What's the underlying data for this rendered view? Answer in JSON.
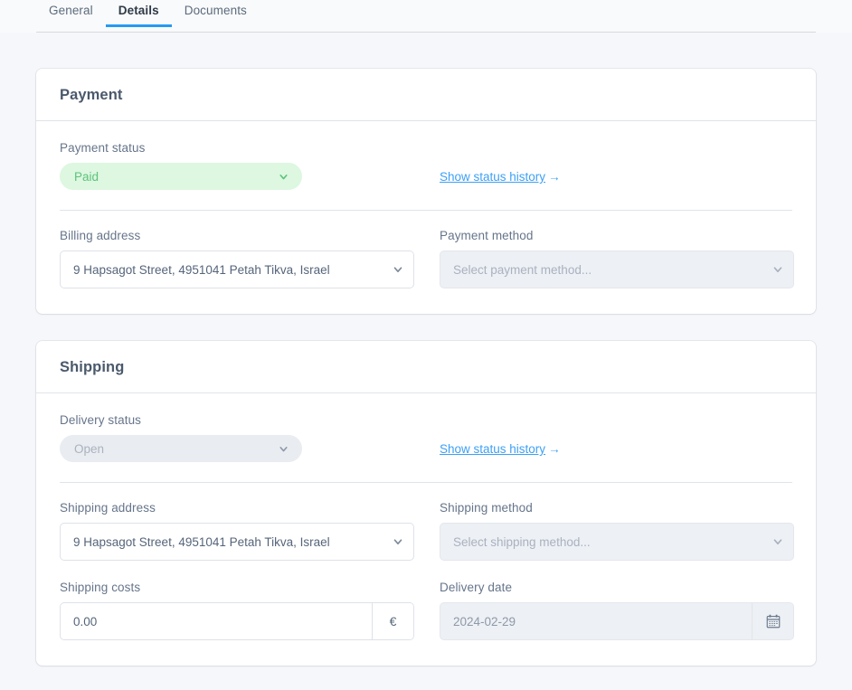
{
  "tabs": [
    {
      "label": "General",
      "active": false
    },
    {
      "label": "Details",
      "active": true
    },
    {
      "label": "Documents",
      "active": false
    }
  ],
  "accent_color": "#269af2",
  "link_color": "#3da0f5",
  "payment": {
    "title": "Payment",
    "status": {
      "label": "Payment status",
      "value": "Paid",
      "pill_bg": "#ddf7e1",
      "pill_text_color": "#5ec37a",
      "history_link": "Show status history",
      "history_arrow": "→"
    },
    "billing_address": {
      "label": "Billing address",
      "value": "9 Hapsagot Street, 4951041 Petah Tikva, Israel"
    },
    "payment_method": {
      "label": "Payment method",
      "placeholder": "Select payment method...",
      "value": ""
    }
  },
  "shipping": {
    "title": "Shipping",
    "status": {
      "label": "Delivery status",
      "value": "Open",
      "pill_bg": "#e9ecf1",
      "pill_text_color": "#aab3be",
      "history_link": "Show status history",
      "history_arrow": "→"
    },
    "shipping_address": {
      "label": "Shipping address",
      "value": "9 Hapsagot Street, 4951041 Petah Tikva, Israel"
    },
    "shipping_method": {
      "label": "Shipping method",
      "placeholder": "Select shipping method...",
      "value": ""
    },
    "shipping_costs": {
      "label": "Shipping costs",
      "value": "0.00",
      "currency": "€"
    },
    "delivery_date": {
      "label": "Delivery date",
      "value": "2024-02-29"
    }
  }
}
